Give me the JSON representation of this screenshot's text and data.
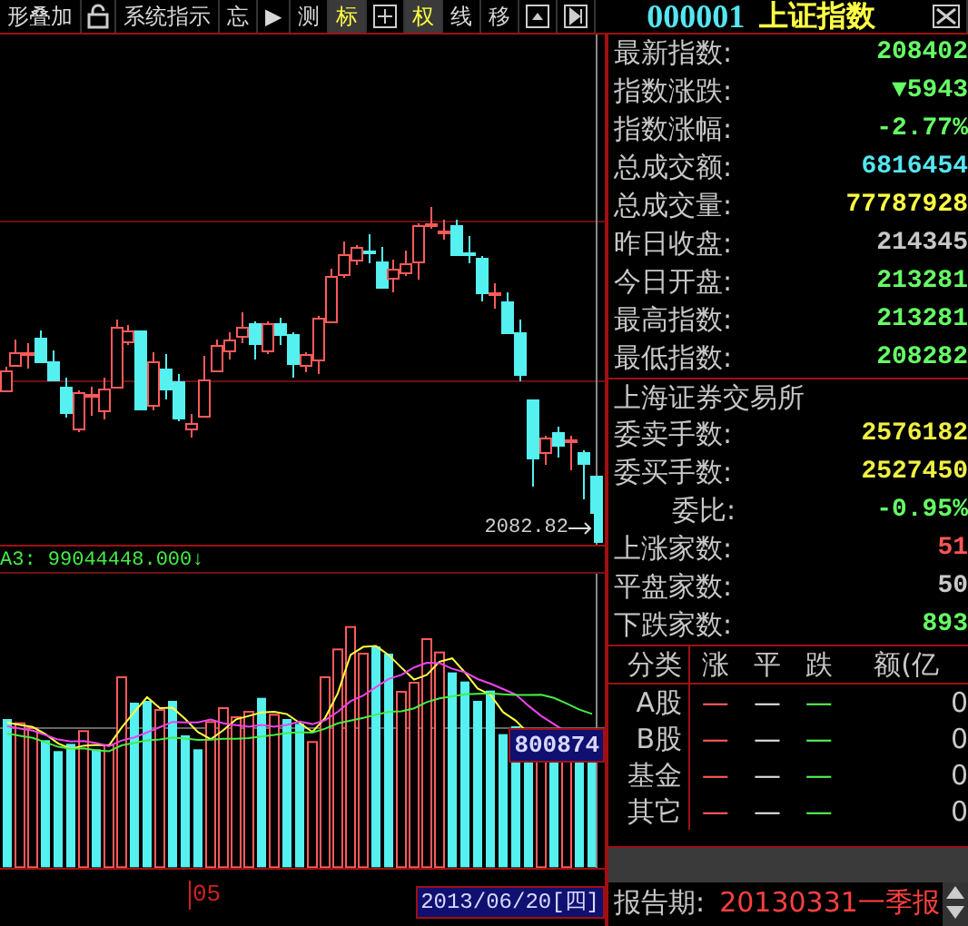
{
  "toolbar": [
    {
      "kind": "text",
      "label": "形叠加",
      "selected": false
    },
    {
      "kind": "icon"
    },
    {
      "kind": "text",
      "label": "系统指示",
      "selected": false
    },
    {
      "kind": "text",
      "label": "忘",
      "selected": false
    },
    {
      "kind": "text",
      "label": "▶",
      "selected": false
    },
    {
      "kind": "text",
      "label": "测",
      "selected": false
    },
    {
      "kind": "text",
      "label": "标",
      "selected": true
    },
    {
      "kind": "icon"
    },
    {
      "kind": "text",
      "label": "权",
      "selected": true
    },
    {
      "kind": "text",
      "label": "线",
      "selected": false
    },
    {
      "kind": "text",
      "label": "移",
      "selected": false
    },
    {
      "kind": "icon"
    },
    {
      "kind": "icon"
    }
  ],
  "title": {
    "code": "000001",
    "name": "上证指数"
  },
  "chart": {
    "price_label": "2082.82",
    "indicator": "A3: 99044448.000↓",
    "volume_label": "800874",
    "axis_tick": "05",
    "date": "2013/06/20[四]"
  },
  "quote": {
    "rows": [
      {
        "label": "最新指数:",
        "value": "208402",
        "color": "#66ff66"
      },
      {
        "label": "指数涨跌:",
        "value": "▼5943",
        "color": "#66ff66"
      },
      {
        "label": "指数涨幅:",
        "value": "-2.77%",
        "color": "#66ff66"
      },
      {
        "label": "总成交额:",
        "value": "6816454",
        "color": "#55e6f0"
      },
      {
        "label": "总成交量:",
        "value": "77787928",
        "color": "#ffff44"
      },
      {
        "label": "昨日收盘:",
        "value": "214345",
        "color": "#c8c8c8"
      },
      {
        "label": "今日开盘:",
        "value": "213281",
        "color": "#66ff66"
      },
      {
        "label": "最高指数:",
        "value": "213281",
        "color": "#66ff66"
      },
      {
        "label": "最低指数:",
        "value": "208282",
        "color": "#66ff66"
      }
    ]
  },
  "exchange": {
    "title": "上海证券交易所",
    "rows": [
      {
        "label": "委卖手数:",
        "value": "2576182",
        "color": "#f0f044",
        "kind": "stat"
      },
      {
        "label": "委买手数:",
        "value": "2527450",
        "color": "#f0f044",
        "kind": "stat"
      },
      {
        "label": "委比:",
        "value": "-0.95%",
        "color": "#66ff66",
        "kind": "ratio"
      },
      {
        "label": "上涨家数:",
        "value": "51",
        "color": "#ff5555",
        "kind": "stat"
      },
      {
        "label": "平盘家数:",
        "value": "50",
        "color": "#c8c8c8",
        "kind": "stat"
      },
      {
        "label": "下跌家数:",
        "value": "893",
        "color": "#66ff66",
        "kind": "stat"
      }
    ]
  },
  "breakdown": {
    "columns": [
      "分类",
      "涨",
      "平",
      "跌",
      "额(亿"
    ],
    "rows": [
      {
        "category": "A股",
        "up": "—",
        "flat": "—",
        "down": "—",
        "amount": "0"
      },
      {
        "category": "B股",
        "up": "—",
        "flat": "—",
        "down": "—",
        "amount": "0"
      },
      {
        "category": "基金",
        "up": "—",
        "flat": "—",
        "down": "—",
        "amount": "0"
      },
      {
        "category": "其它",
        "up": "—",
        "flat": "—",
        "down": "—",
        "amount": "0"
      }
    ]
  },
  "report": {
    "label": "报告期:",
    "value": "20130331一季报"
  }
}
